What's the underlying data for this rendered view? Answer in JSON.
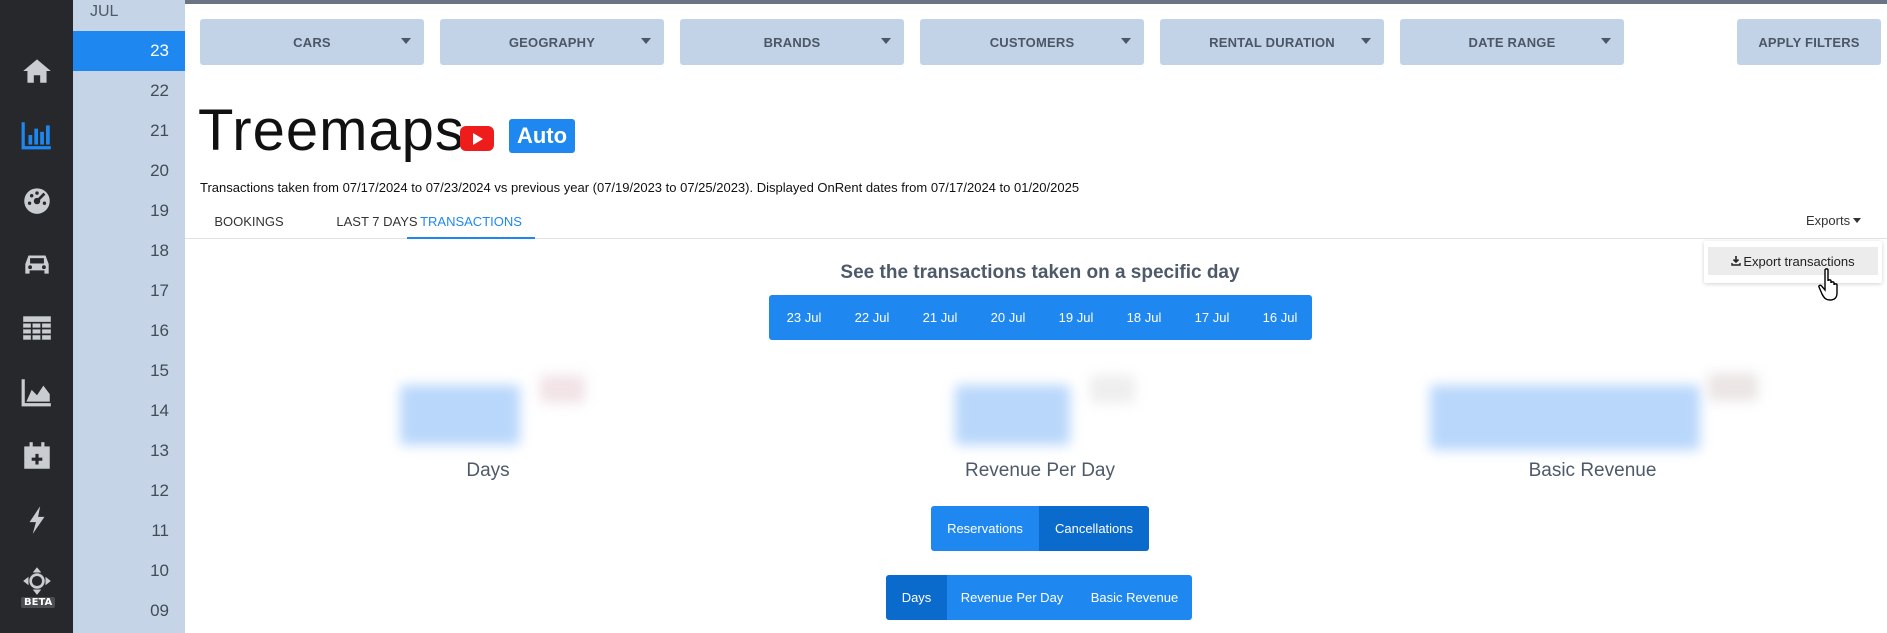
{
  "rail": {
    "items": [
      "home-icon",
      "bar-chart-icon",
      "dashboard-gauge-icon",
      "car-icon",
      "table-grid-icon",
      "area-chart-icon",
      "calendar-add-icon",
      "lightning-icon",
      "move-arrows-icon"
    ],
    "active": "bar-chart-icon",
    "beta_label": "BETA"
  },
  "dates": {
    "month": "JUL",
    "days": [
      "23",
      "22",
      "21",
      "20",
      "19",
      "18",
      "17",
      "16",
      "15",
      "14",
      "13",
      "12",
      "11",
      "10",
      "09"
    ],
    "selected": "23"
  },
  "filters": {
    "items": [
      "CARS",
      "GEOGRAPHY",
      "BRANDS",
      "CUSTOMERS",
      "RENTAL DURATION",
      "DATE RANGE"
    ],
    "apply": "APPLY FILTERS"
  },
  "page": {
    "title": "Treemaps",
    "badge": "Auto",
    "subtitle": "Transactions taken from 07/17/2024 to 07/23/2024 vs previous year (07/19/2023 to 07/25/2023). Displayed OnRent dates from 07/17/2024 to 01/20/2025"
  },
  "tabs": {
    "items": [
      "BOOKINGS",
      "LAST 7 DAYS",
      "TRANSACTIONS"
    ],
    "active": "TRANSACTIONS"
  },
  "exports": {
    "label": "Exports",
    "menu_item": "Export transactions"
  },
  "day_selector": {
    "heading": "See the transactions taken on a specific day",
    "days": [
      "23 Jul",
      "22 Jul",
      "21 Jul",
      "20 Jul",
      "19 Jul",
      "18 Jul",
      "17 Jul",
      "16 Jul"
    ]
  },
  "metrics": {
    "labels": [
      "Days",
      "Revenue Per Day",
      "Basic Revenue"
    ]
  },
  "type_toggle": {
    "items": [
      "Reservations",
      "Cancellations"
    ],
    "active": "Cancellations"
  },
  "metric_toggle": {
    "items": [
      "Days",
      "Revenue Per Day",
      "Basic Revenue"
    ],
    "active": "Days"
  },
  "colors": {
    "accent": "#1e88f0",
    "accent_dark": "#0b6bcd",
    "rail_bg": "#26282b",
    "datecol_bg": "#c5d4e7",
    "filter_bg": "#c3d3e7",
    "youtube_red": "#ee1c1b"
  }
}
